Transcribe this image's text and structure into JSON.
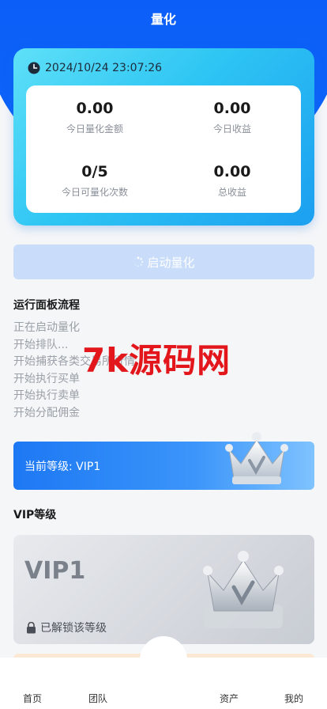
{
  "header": {
    "title": "量化"
  },
  "stats": {
    "datetime": "2024/10/24 23:07:26",
    "items": [
      {
        "value": "0.00",
        "label": "今日量化金额"
      },
      {
        "value": "0.00",
        "label": "今日收益"
      },
      {
        "value": "0/5",
        "label": "今日可量化次数"
      },
      {
        "value": "0.00",
        "label": "总收益"
      }
    ]
  },
  "start_button": {
    "label": "启动量化"
  },
  "flow": {
    "title": "运行面板流程",
    "steps": [
      "正在启动量化",
      "开始排队...",
      "开始捕获各类交易所行情",
      "开始执行买单",
      "开始执行卖单",
      "开始分配佣金"
    ]
  },
  "watermark": {
    "text": "7k源码网"
  },
  "current_level": {
    "text": "当前等级: VIP1"
  },
  "vip_section": {
    "title": "VIP等级",
    "card_name": "VIP1",
    "unlock_text": "已解锁该等级"
  },
  "tabbar": {
    "items": [
      "首页",
      "团队",
      "资产",
      "我的"
    ]
  },
  "colors": {
    "primary": "#0a58f6",
    "accent_cyan": "#2ec5f3",
    "button_disabled": "#c9ddfb",
    "watermark_red": "#e2161b"
  }
}
